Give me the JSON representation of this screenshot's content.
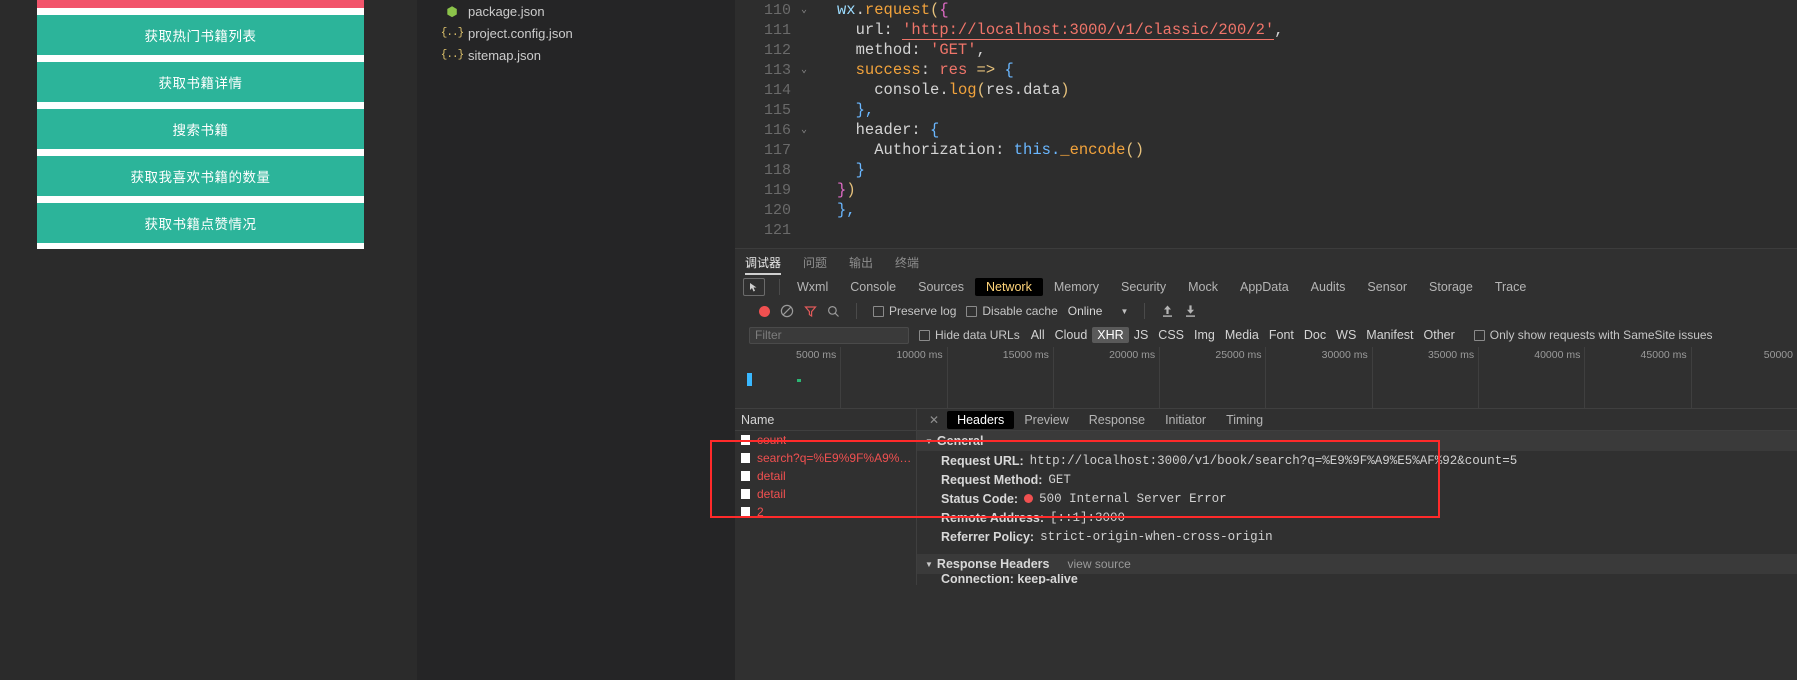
{
  "simulator": {
    "buttons": [
      {
        "label": "",
        "color": "pink",
        "partial": true
      },
      {
        "label": "获取热门书籍列表",
        "color": "green"
      },
      {
        "label": "获取书籍详情",
        "color": "green"
      },
      {
        "label": "搜索书籍",
        "color": "green"
      },
      {
        "label": "获取我喜欢书籍的数量",
        "color": "green"
      },
      {
        "label": "获取书籍点赞情况",
        "color": "green"
      }
    ],
    "colors": {
      "pink": "#f2546b",
      "green": "#2cb49a"
    }
  },
  "filetree": {
    "files": [
      {
        "name": "package.json",
        "icon": "nodejs-icon"
      },
      {
        "name": "project.config.json",
        "icon": "json-braces-icon"
      },
      {
        "name": "sitemap.json",
        "icon": "json-braces-icon"
      }
    ]
  },
  "editor": {
    "lines": [
      {
        "num": "110",
        "fold": "⌄"
      },
      {
        "num": "111",
        "fold": ""
      },
      {
        "num": "112",
        "fold": ""
      },
      {
        "num": "113",
        "fold": "⌄"
      },
      {
        "num": "114",
        "fold": ""
      },
      {
        "num": "115",
        "fold": ""
      },
      {
        "num": "116",
        "fold": "⌄"
      },
      {
        "num": "117",
        "fold": ""
      },
      {
        "num": "118",
        "fold": ""
      },
      {
        "num": "119",
        "fold": ""
      },
      {
        "num": "120",
        "fold": ""
      },
      {
        "num": "121",
        "fold": ""
      }
    ],
    "code": {
      "l110_a": "wx",
      "l110_b": ".",
      "l110_c": "request",
      "l110_d": "(",
      "l110_e": "{",
      "l111_key": "url",
      "l111_colon": ": ",
      "l111_str": "'http://localhost:3000/v1/classic/200/2'",
      "l111_end": ",",
      "l112_key": "method",
      "l112_colon": ": ",
      "l112_str": "'GET'",
      "l112_end": ",",
      "l113_key": "success",
      "l113_colon": ": ",
      "l113_res": "res",
      "l113_arrow": " => ",
      "l113_brace": "{",
      "l114_a": "console",
      "l114_dot": ".",
      "l114_log": "log",
      "l114_p1": "(",
      "l114_arg": "res.data",
      "l114_p2": ")",
      "l115": "},",
      "l116_key": "header",
      "l116_colon": ": ",
      "l116_brace": "{",
      "l117_key": "Authorization",
      "l117_colon": ": ",
      "l117_this": "this.",
      "l117_fn": "_encode",
      "l117_p": "()",
      "l118": "}",
      "l119_a": "}",
      "l119_b": ")",
      "l120": "},",
      "l121": ""
    }
  },
  "devtools": {
    "outer_tabs": [
      {
        "label": "调试器",
        "active": true
      },
      {
        "label": "问题",
        "active": false
      },
      {
        "label": "输出",
        "active": false
      },
      {
        "label": "终端",
        "active": false
      }
    ],
    "panel_tabs": [
      {
        "label": "Wxml",
        "active": false
      },
      {
        "label": "Console",
        "active": false
      },
      {
        "label": "Sources",
        "active": false
      },
      {
        "label": "Network",
        "active": true
      },
      {
        "label": "Memory",
        "active": false
      },
      {
        "label": "Security",
        "active": false
      },
      {
        "label": "Mock",
        "active": false
      },
      {
        "label": "AppData",
        "active": false
      },
      {
        "label": "Audits",
        "active": false
      },
      {
        "label": "Sensor",
        "active": false
      },
      {
        "label": "Storage",
        "active": false
      },
      {
        "label": "Trace",
        "active": false
      }
    ],
    "toolbar": {
      "record_title": "record-button",
      "clear_title": "clear-button",
      "filter_title": "filter-button",
      "search_title": "search-button",
      "preserve_log": "Preserve log",
      "disable_cache": "Disable cache",
      "throttling": "Online",
      "import_title": "import-har",
      "export_title": "export-har"
    },
    "filterbar": {
      "filter_placeholder": "Filter",
      "hide_data_urls": "Hide data URLs",
      "types": [
        {
          "label": "All",
          "active": false
        },
        {
          "label": "Cloud",
          "active": false
        },
        {
          "label": "XHR",
          "active": true
        },
        {
          "label": "JS",
          "active": false
        },
        {
          "label": "CSS",
          "active": false
        },
        {
          "label": "Img",
          "active": false
        },
        {
          "label": "Media",
          "active": false
        },
        {
          "label": "Font",
          "active": false
        },
        {
          "label": "Doc",
          "active": false
        },
        {
          "label": "WS",
          "active": false
        },
        {
          "label": "Manifest",
          "active": false
        },
        {
          "label": "Other",
          "active": false
        }
      ],
      "samesite": "Only show requests with SameSite issues"
    },
    "overview": {
      "ticks": [
        "5000 ms",
        "10000 ms",
        "15000 ms",
        "20000 ms",
        "25000 ms",
        "30000 ms",
        "35000 ms",
        "40000 ms",
        "45000 ms",
        "50000 "
      ]
    },
    "requests": {
      "header": "Name",
      "rows": [
        {
          "name": "count"
        },
        {
          "name": "search?q=%E9%9F%A9%E5%…"
        },
        {
          "name": "detail"
        },
        {
          "name": "detail"
        },
        {
          "name": "2"
        }
      ]
    },
    "details": {
      "tabs": [
        {
          "label": "Headers",
          "active": true
        },
        {
          "label": "Preview",
          "active": false
        },
        {
          "label": "Response",
          "active": false
        },
        {
          "label": "Initiator",
          "active": false
        },
        {
          "label": "Timing",
          "active": false
        }
      ],
      "general_title": "General",
      "general_rows": [
        {
          "key": "Request URL:",
          "value": "http://localhost:3000/v1/book/search?q=%E9%9F%A9%E5%AF%92&count=5",
          "status": false
        },
        {
          "key": "Request Method:",
          "value": "GET",
          "status": false
        },
        {
          "key": "Status Code:",
          "value": "500 Internal Server Error",
          "status": true
        },
        {
          "key": "Remote Address:",
          "value": "[::1]:3000",
          "status": false
        },
        {
          "key": "Referrer Policy:",
          "value": "strict-origin-when-cross-origin",
          "status": false
        }
      ],
      "response_headers_title": "Response Headers",
      "view_source": "view source",
      "partial_row": "Connection: keep-alive"
    }
  },
  "annotation": {
    "highlight_color": "#ff2a2a"
  }
}
